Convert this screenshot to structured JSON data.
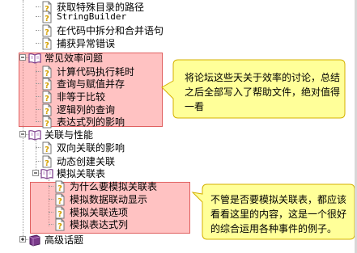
{
  "tree": {
    "items": [
      {
        "label": "获取特殊目录的路径",
        "icon": "help-page-icon"
      },
      {
        "label": "StringBuilder",
        "icon": "help-page-icon"
      },
      {
        "label": "在代码中拆分和合并语句",
        "icon": "help-page-icon"
      },
      {
        "label": "捕获异常错误",
        "icon": "help-page-icon"
      },
      {
        "label": "常见效率问题",
        "icon": "open-book-icon",
        "expanded": true
      },
      {
        "label": "计算代码执行耗时",
        "icon": "help-page-icon"
      },
      {
        "label": "查询与赋值并存",
        "icon": "help-page-icon"
      },
      {
        "label": "非等于比较",
        "icon": "help-page-icon"
      },
      {
        "label": "逻辑列的查询",
        "icon": "help-page-icon"
      },
      {
        "label": "表达式列的影响",
        "icon": "help-page-icon"
      },
      {
        "label": "关联与性能",
        "icon": "open-book-icon",
        "expanded": true
      },
      {
        "label": "双向关联的影响",
        "icon": "help-page-icon"
      },
      {
        "label": "动态创建关联",
        "icon": "help-page-icon"
      },
      {
        "label": "模拟关联表",
        "icon": "open-book-icon",
        "expanded": true
      },
      {
        "label": "为什么要模拟关联表",
        "icon": "help-page-icon"
      },
      {
        "label": "模拟数据联动显示",
        "icon": "help-page-icon"
      },
      {
        "label": "模拟关联选项",
        "icon": "help-page-icon"
      },
      {
        "label": "模拟表达式列",
        "icon": "help-page-icon"
      },
      {
        "label": "高级话题",
        "icon": "closed-book-icon",
        "expanded": false
      }
    ]
  },
  "callouts": [
    {
      "text_lines": [
        "将论坛这些天关于效率的讨论，总结",
        "之后全部写入了帮助文件，绝对值得",
        "一看"
      ]
    },
    {
      "text_lines": [
        "不管是否要模拟关联表，都应该",
        "看看这里的内容，这是一个很好",
        "的综合运用各种事件的例子。"
      ]
    }
  ],
  "colors": {
    "highlight_fill": "#ff8080",
    "highlight_border": "#e06060",
    "callout_fill": "#ffff99",
    "callout_border": "#d4b000",
    "tree_lines": "#9a9a9a",
    "book_color": "#7a3a8a",
    "help_icon_color": "#d4a000"
  }
}
